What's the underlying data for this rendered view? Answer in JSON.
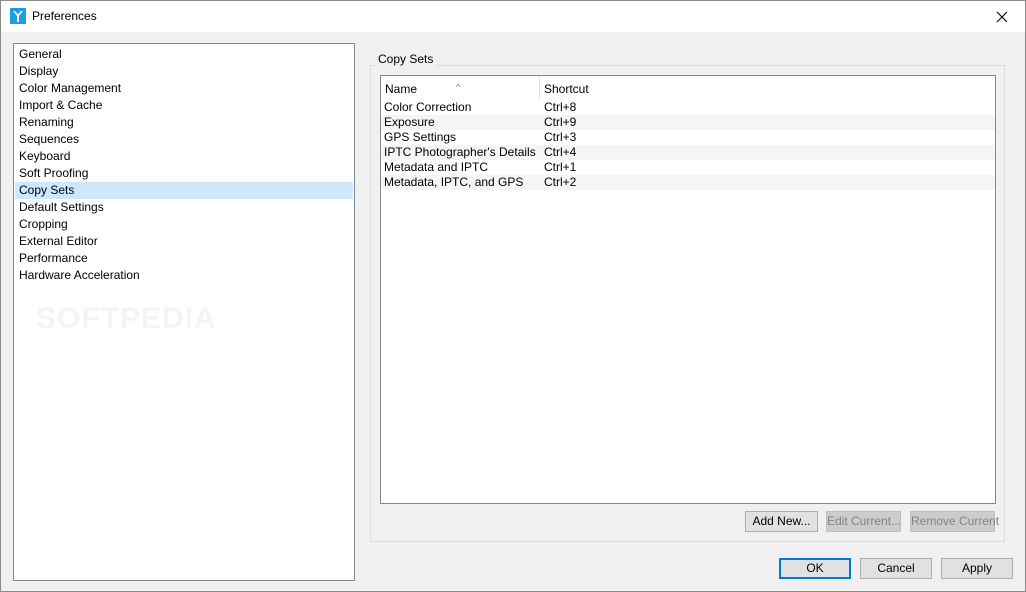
{
  "window": {
    "title": "Preferences"
  },
  "sidebar": {
    "items": [
      {
        "label": "General",
        "selected": false
      },
      {
        "label": "Display",
        "selected": false
      },
      {
        "label": "Color Management",
        "selected": false
      },
      {
        "label": "Import & Cache",
        "selected": false
      },
      {
        "label": "Renaming",
        "selected": false
      },
      {
        "label": "Sequences",
        "selected": false
      },
      {
        "label": "Keyboard",
        "selected": false
      },
      {
        "label": "Soft Proofing",
        "selected": false
      },
      {
        "label": "Copy Sets",
        "selected": true
      },
      {
        "label": "Default Settings",
        "selected": false
      },
      {
        "label": "Cropping",
        "selected": false
      },
      {
        "label": "External Editor",
        "selected": false
      },
      {
        "label": "Performance",
        "selected": false
      },
      {
        "label": "Hardware Acceleration",
        "selected": false
      }
    ],
    "watermark": "SOFTPEDIA"
  },
  "copy_sets": {
    "group_label": "Copy Sets",
    "columns": {
      "name": "Name",
      "shortcut": "Shortcut"
    },
    "rows": [
      {
        "name": "Color Correction",
        "shortcut": "Ctrl+8"
      },
      {
        "name": "Exposure",
        "shortcut": "Ctrl+9"
      },
      {
        "name": "GPS Settings",
        "shortcut": "Ctrl+3"
      },
      {
        "name": "IPTC Photographer's Details",
        "shortcut": "Ctrl+4"
      },
      {
        "name": "Metadata and IPTC",
        "shortcut": "Ctrl+1"
      },
      {
        "name": "Metadata, IPTC, and GPS",
        "shortcut": "Ctrl+2"
      }
    ],
    "add_new_label": "Add New...",
    "edit_current_label": "Edit Current...",
    "remove_current_label": "Remove Current"
  },
  "footer": {
    "ok_label": "OK",
    "cancel_label": "Cancel",
    "apply_label": "Apply"
  },
  "colors": {
    "selection": "#cce8ff",
    "app_icon": "#1e9fe0",
    "default_button_border": "#0078d7"
  }
}
